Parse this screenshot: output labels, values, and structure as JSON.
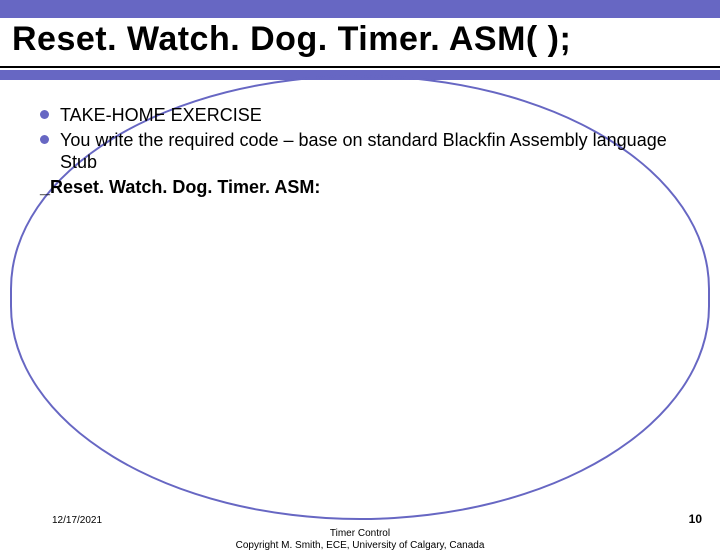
{
  "title": "Reset. Watch. Dog. Timer. ASM( );",
  "bullets": {
    "b1": "TAKE-HOME EXERCISE",
    "b2": "You write the required code – base on standard Blackfin Assembly language Stub"
  },
  "stub_label": "_Reset. Watch. Dog. Timer. ASM:",
  "footer": {
    "date": "12/17/2021",
    "line1": "Timer Control",
    "line2": "Copyright M. Smith, ECE, University of Calgary, Canada",
    "page": "10"
  }
}
